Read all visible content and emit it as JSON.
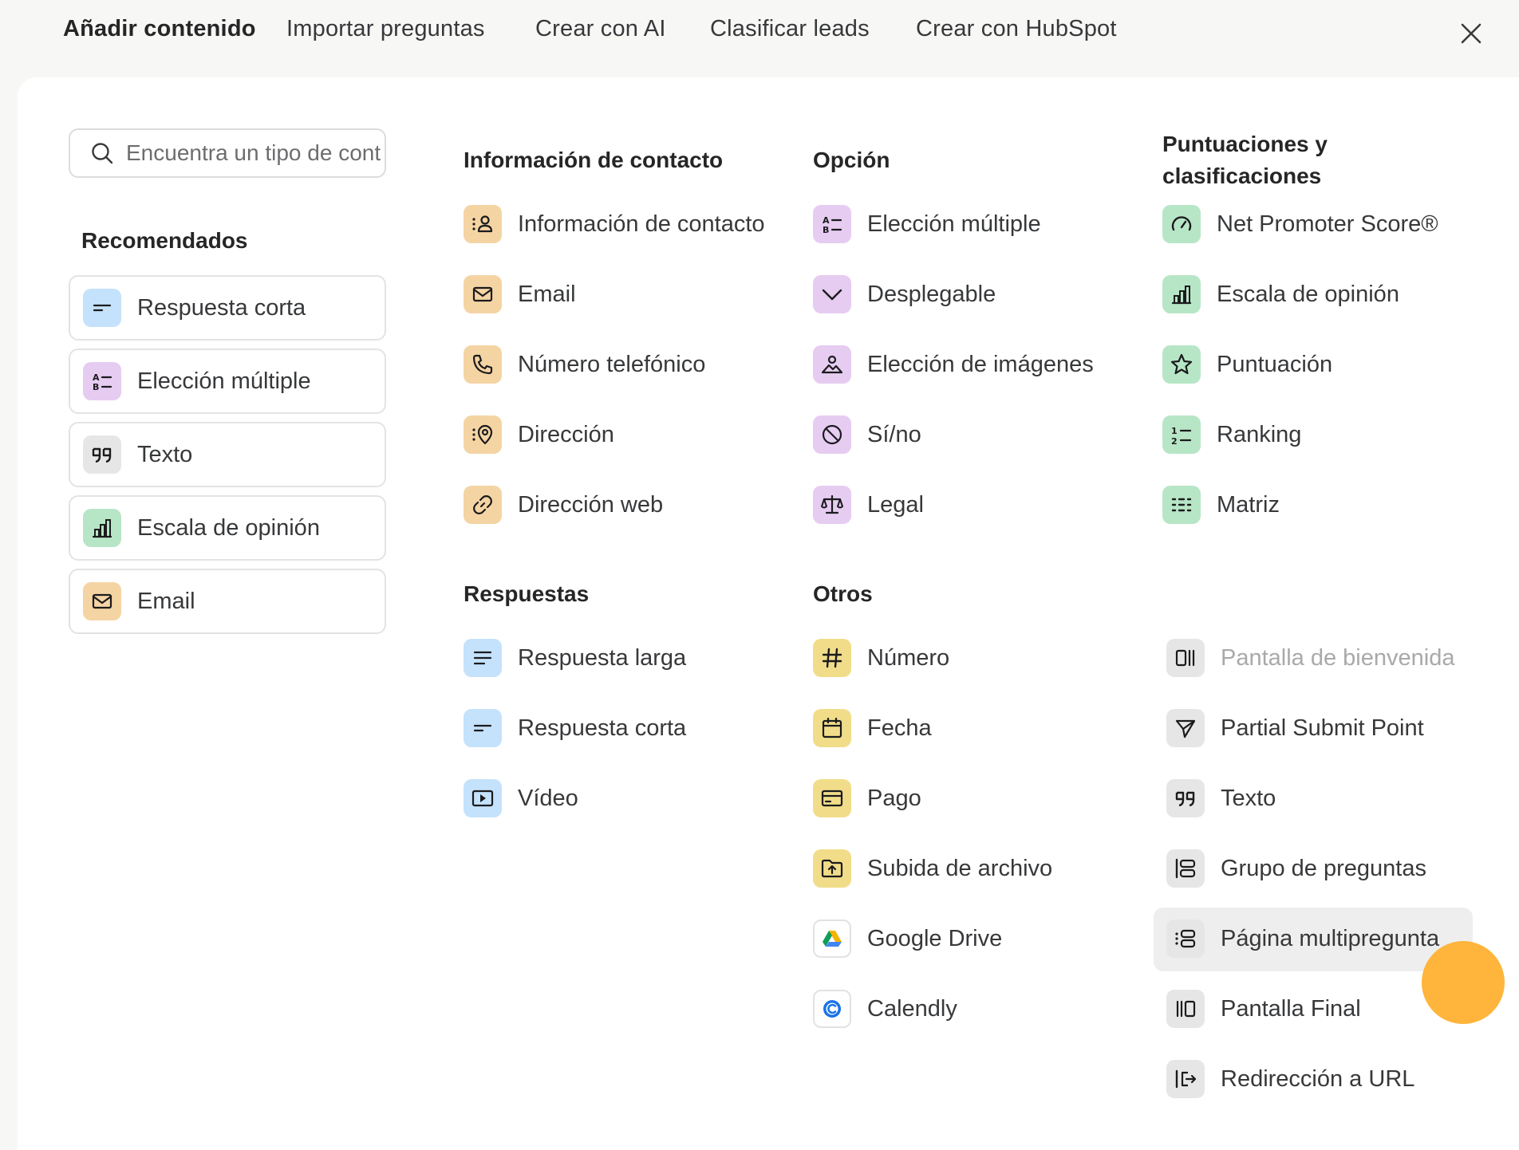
{
  "tabs": [
    "Añadir contenido",
    "Importar preguntas",
    "Crear con AI",
    "Clasificar leads",
    "Crear con HubSpot"
  ],
  "search": {
    "placeholder": "Encuentra un tipo de contenido"
  },
  "recommended": {
    "title": "Recomendados",
    "items": [
      {
        "label": "Respuesta corta",
        "icon": "short-text-icon",
        "color": "blue"
      },
      {
        "label": "Elección múltiple",
        "icon": "multiple-choice-icon",
        "color": "purple"
      },
      {
        "label": "Texto",
        "icon": "quote-icon",
        "color": "gray"
      },
      {
        "label": "Escala de opinión",
        "icon": "bar-chart-icon",
        "color": "green"
      },
      {
        "label": "Email",
        "icon": "mail-icon",
        "color": "orange"
      }
    ]
  },
  "sections": {
    "contact": {
      "title": "Información de contacto",
      "items": [
        {
          "label": "Información de contacto",
          "icon": "contact-card-icon"
        },
        {
          "label": "Email",
          "icon": "mail-icon"
        },
        {
          "label": "Número telefónico",
          "icon": "phone-icon"
        },
        {
          "label": "Dirección",
          "icon": "location-icon"
        },
        {
          "label": "Dirección web",
          "icon": "link-icon"
        }
      ]
    },
    "choice": {
      "title": "Opción",
      "items": [
        {
          "label": "Elección múltiple",
          "icon": "multiple-choice-icon"
        },
        {
          "label": "Desplegable",
          "icon": "chevron-down-icon"
        },
        {
          "label": "Elección de imágenes",
          "icon": "image-person-icon"
        },
        {
          "label": "Sí/no",
          "icon": "yes-no-icon"
        },
        {
          "label": "Legal",
          "icon": "scales-icon"
        }
      ]
    },
    "ratings": {
      "title": "Puntuaciones y clasificaciones",
      "items": [
        {
          "label": "Net Promoter Score®",
          "icon": "gauge-icon"
        },
        {
          "label": "Escala de opinión",
          "icon": "bar-chart-icon"
        },
        {
          "label": "Puntuación",
          "icon": "star-icon"
        },
        {
          "label": "Ranking",
          "icon": "ranking-icon"
        },
        {
          "label": "Matriz",
          "icon": "matrix-icon"
        }
      ]
    },
    "answers": {
      "title": "Respuestas",
      "items": [
        {
          "label": "Respuesta larga",
          "icon": "long-text-icon"
        },
        {
          "label": "Respuesta corta",
          "icon": "short-text-icon"
        },
        {
          "label": "Vídeo",
          "icon": "video-icon"
        }
      ]
    },
    "others": {
      "title": "Otros",
      "items": [
        {
          "label": "Número",
          "icon": "hash-icon"
        },
        {
          "label": "Fecha",
          "icon": "calendar-icon"
        },
        {
          "label": "Pago",
          "icon": "credit-card-icon"
        },
        {
          "label": "Subida de archivo",
          "icon": "folder-upload-icon"
        },
        {
          "label": "Google Drive",
          "icon": "google-drive-icon"
        },
        {
          "label": "Calendly",
          "icon": "calendly-icon"
        }
      ]
    },
    "structure": {
      "items": [
        {
          "label": "Pantalla de bienvenida",
          "icon": "welcome-screen-icon",
          "disabled": true
        },
        {
          "label": "Partial Submit Point",
          "icon": "send-icon"
        },
        {
          "label": "Texto",
          "icon": "quote-icon"
        },
        {
          "label": "Grupo de preguntas",
          "icon": "question-group-icon"
        },
        {
          "label": "Página multipregunta",
          "icon": "multi-question-page-icon",
          "hovered": true
        },
        {
          "label": "Pantalla Final",
          "icon": "end-screen-icon"
        },
        {
          "label": "Redirección a URL",
          "icon": "redirect-icon"
        }
      ]
    }
  },
  "colors": {
    "orange": "#f5d4a4",
    "purple": "#e6ccf1",
    "green": "#b7e6c6",
    "blue": "#c4e2fb",
    "yellow": "#f1dd89",
    "gray": "#e6e6e6",
    "cursor": "#ffb130"
  }
}
